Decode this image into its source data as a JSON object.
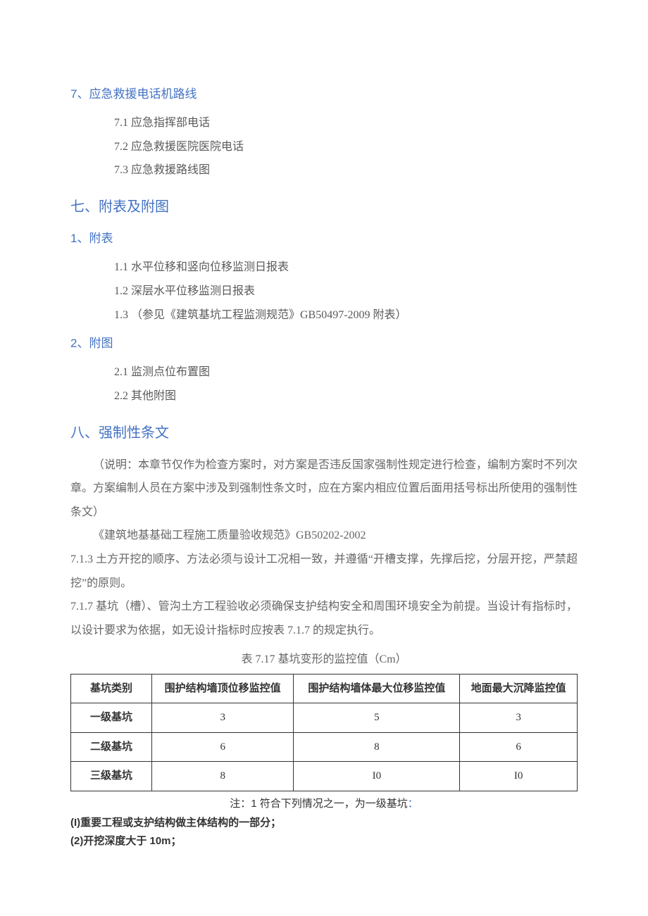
{
  "section7": {
    "num": "7",
    "sep": "、",
    "title": "应急救援电话机路线",
    "items": [
      "7.1  应急指挥部电话",
      "7.2  应急救援医院医院电话",
      "7.3  应急救援路线图"
    ]
  },
  "chapter7": {
    "title": "七、附表及附图"
  },
  "appendixTables": {
    "num": "1",
    "sep": "、",
    "title": "附表",
    "items": [
      "1.1  水平位移和竖向位移监测日报表",
      "1.2  深层水平位移监测日报表",
      "1.3  （参见《建筑基坑工程监测规范》GB50497-2009 附表）"
    ]
  },
  "appendixFigures": {
    "num": "2",
    "sep": "、",
    "title": "附图",
    "items": [
      "2.1  监测点位布置图",
      "2.2  其他附图"
    ]
  },
  "chapter8": {
    "title": "八、强制性条文",
    "note": "（说明：本章节仅作为检查方案时，对方案是否违反国家强制性规定进行检查，编制方案时不列次章。方案编制人员在方案中涉及到强制性条文时，应在方案内相应位置后面用括号标出所使用的强制性条文）",
    "ref": "《建筑地基基础工程施工质量验收规范》GB50202-2002",
    "clause713": "7.1.3 土方开挖的顺序、方法必须与设计工况相一致，并遵循“开槽支撑，先撑后挖，分层开挖，严禁超挖”的原则。",
    "clause717": "7.1.7 基坑（槽）、管沟土方工程验收必须确保支护结构安全和周围环境安全为前提。当设计有指标时，以设计要求为依据，如无设计指标时应按表 7.1.7 的规定执行。"
  },
  "table": {
    "caption": "表 7.17 基坑变形的监控值（Cm）",
    "headers": [
      "基坑类别",
      "围护结构墙顶位移监控值",
      "围护结构墙体最大位移监控值",
      "地面最大沉降监控值"
    ],
    "rows": [
      [
        "一级基坑",
        "3",
        "5",
        "3"
      ],
      [
        "二级基坑",
        "6",
        "8",
        "6"
      ],
      [
        "三级基坑",
        "8",
        "I0",
        "I0"
      ]
    ],
    "noteLabel": "注：1 符合下列情况之一，为一级基坑",
    "noteColon": "：",
    "footnotes": [
      "(I)重要工程或支护结构做主体结构的一部分；",
      "(2)开挖深度大于 10m；"
    ]
  }
}
